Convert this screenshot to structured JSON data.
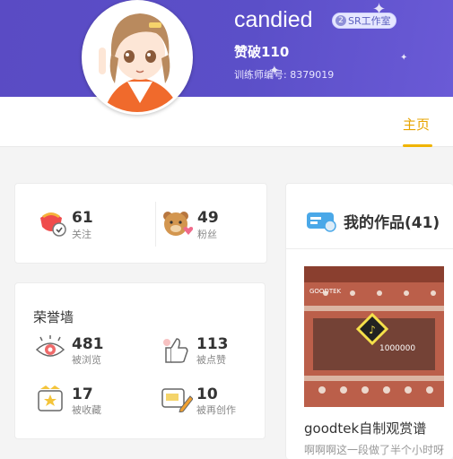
{
  "profile": {
    "username": "candied",
    "badge_num": "2",
    "badge_label": "SR工作室",
    "likes": "赞破110",
    "trainer_id": "训练师编号: 8379019"
  },
  "tabs": {
    "home": "主页"
  },
  "follow": {
    "following_count": "61",
    "following_label": "关注",
    "fans_count": "49",
    "fans_label": "粉丝"
  },
  "honor": {
    "title": "荣誉墙",
    "items": [
      {
        "count": "481",
        "label": "被浏览",
        "icon": "eye-icon"
      },
      {
        "count": "113",
        "label": "被点赞",
        "icon": "thumb-up-icon"
      },
      {
        "count": "17",
        "label": "被收藏",
        "icon": "star-box-icon"
      },
      {
        "count": "10",
        "label": "被再创作",
        "icon": "edit-card-icon"
      }
    ]
  },
  "works": {
    "title": "我的作品(41)",
    "item": {
      "title": "goodtek自制观赏谱",
      "desc": "啊啊啊这一段做了半个小时呀",
      "thumb_text": "GOODTEK",
      "thumb_score": "1000000"
    }
  },
  "colors": {
    "banner": "#5a4bc4",
    "accent": "#f0b400"
  }
}
